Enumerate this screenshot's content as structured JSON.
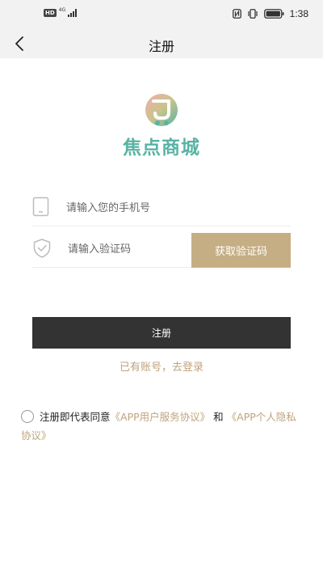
{
  "status_bar": {
    "hd": "HD",
    "network": "4G",
    "time": "1:38",
    "icons": [
      "signal-icon",
      "nfc-icon",
      "vibrate-icon",
      "battery-icon"
    ]
  },
  "header": {
    "title": "注册",
    "back_icon": "chevron-left-icon"
  },
  "logo": {
    "text": "焦点商城",
    "color": "#58b3a4"
  },
  "form": {
    "phone_placeholder": "请输入您的手机号",
    "code_placeholder": "请输入验证码",
    "get_code_label": "获取验证码",
    "register_label": "注册"
  },
  "login_link": "已有账号，去登录",
  "agreement": {
    "prefix": "注册即代表同意",
    "service_link": "《APP用户服务协议》",
    "and": "和",
    "privacy_link": "《APP个人隐私协议》",
    "checked": false
  },
  "colors": {
    "accent": "#c5ad84",
    "link": "#bfa47c",
    "primary_button": "#333333",
    "bar_background": "#f2f2f2"
  }
}
